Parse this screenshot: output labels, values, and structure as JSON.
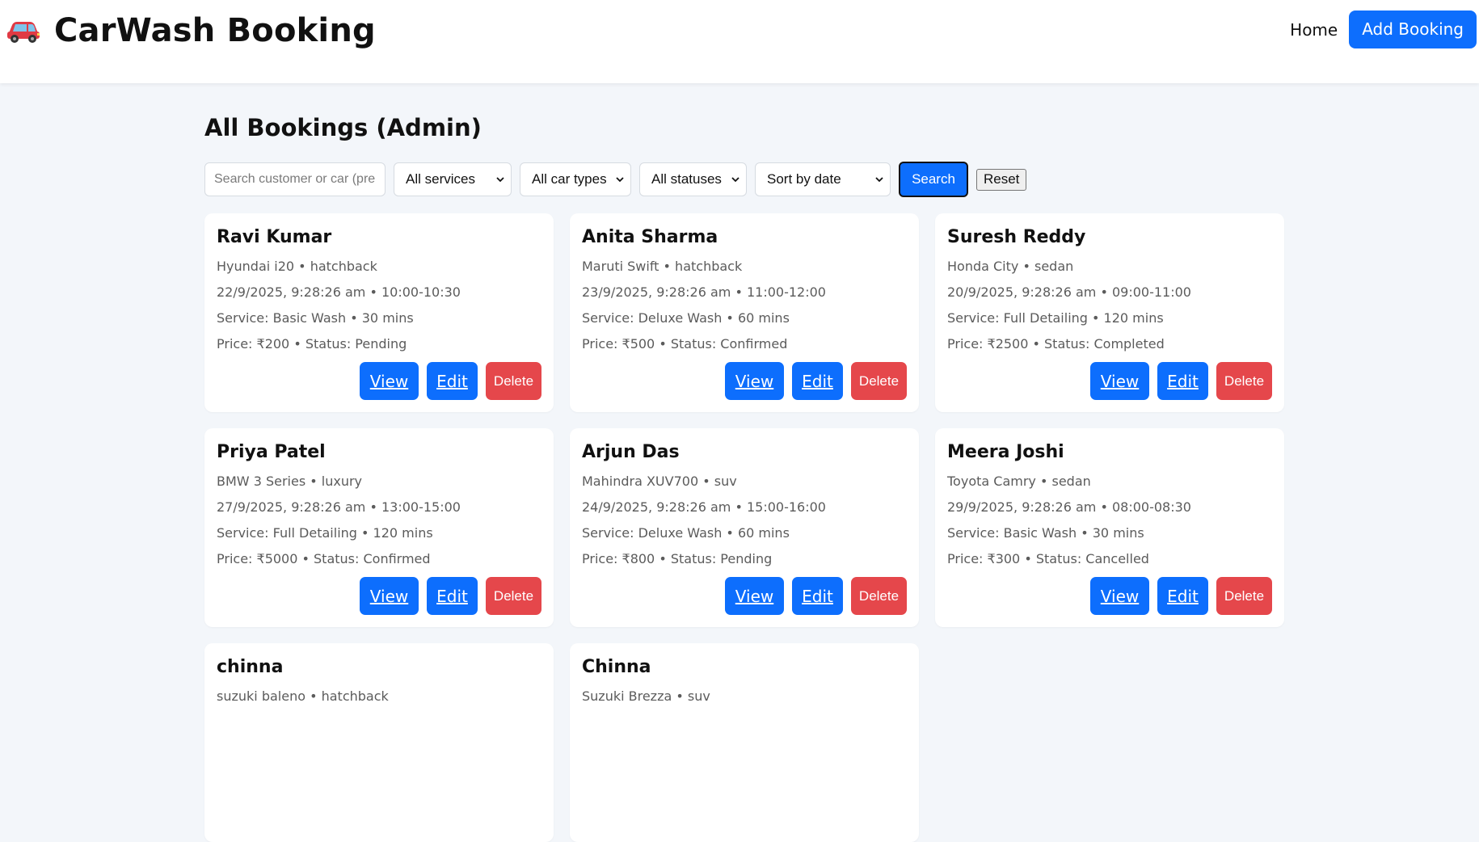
{
  "header": {
    "brand_icon": "red-car-icon",
    "title": "CarWash Booking",
    "nav_home": "Home",
    "nav_add": "Add Booking"
  },
  "page": {
    "title": "All Bookings (Admin)"
  },
  "filters": {
    "search_placeholder": "Search customer or car (pre",
    "service_select": "All services",
    "car_type_select": "All car types",
    "status_select": "All statuses",
    "sort_select": "Sort by date",
    "search_button": "Search",
    "reset_button": "Reset"
  },
  "card_actions": {
    "view": "View",
    "edit": "Edit",
    "delete": "Delete"
  },
  "colors": {
    "primary": "#0d6efd",
    "danger": "#e5474b",
    "page_background": "#f3f6fa"
  },
  "bookings": [
    {
      "name": "Ravi Kumar",
      "car": "Hyundai i20 • hatchback",
      "datetime": "22/9/2025, 9:28:26 am • 10:00-10:30",
      "service": "Service: Basic Wash • 30 mins",
      "price_status": "Price: ₹200 • Status: Pending"
    },
    {
      "name": "Anita Sharma",
      "car": "Maruti Swift • hatchback",
      "datetime": "23/9/2025, 9:28:26 am • 11:00-12:00",
      "service": "Service: Deluxe Wash • 60 mins",
      "price_status": "Price: ₹500 • Status: Confirmed"
    },
    {
      "name": "Suresh Reddy",
      "car": "Honda City • sedan",
      "datetime": "20/9/2025, 9:28:26 am • 09:00-11:00",
      "service": "Service: Full Detailing • 120 mins",
      "price_status": "Price: ₹2500 • Status: Completed"
    },
    {
      "name": "Priya Patel",
      "car": "BMW 3 Series • luxury",
      "datetime": "27/9/2025, 9:28:26 am • 13:00-15:00",
      "service": "Service: Full Detailing • 120 mins",
      "price_status": "Price: ₹5000 • Status: Confirmed"
    },
    {
      "name": "Arjun Das",
      "car": "Mahindra XUV700 • suv",
      "datetime": "24/9/2025, 9:28:26 am • 15:00-16:00",
      "service": "Service: Deluxe Wash • 60 mins",
      "price_status": "Price: ₹800 • Status: Pending"
    },
    {
      "name": "Meera Joshi",
      "car": "Toyota Camry • sedan",
      "datetime": "29/9/2025, 9:28:26 am • 08:00-08:30",
      "service": "Service: Basic Wash • 30 mins",
      "price_status": "Price: ₹300 • Status: Cancelled"
    },
    {
      "name": "chinna",
      "car": "suzuki baleno • hatchback",
      "datetime": "",
      "service": "",
      "price_status": ""
    },
    {
      "name": "Chinna",
      "car": "Suzuki Brezza • suv",
      "datetime": "",
      "service": "",
      "price_status": ""
    }
  ]
}
